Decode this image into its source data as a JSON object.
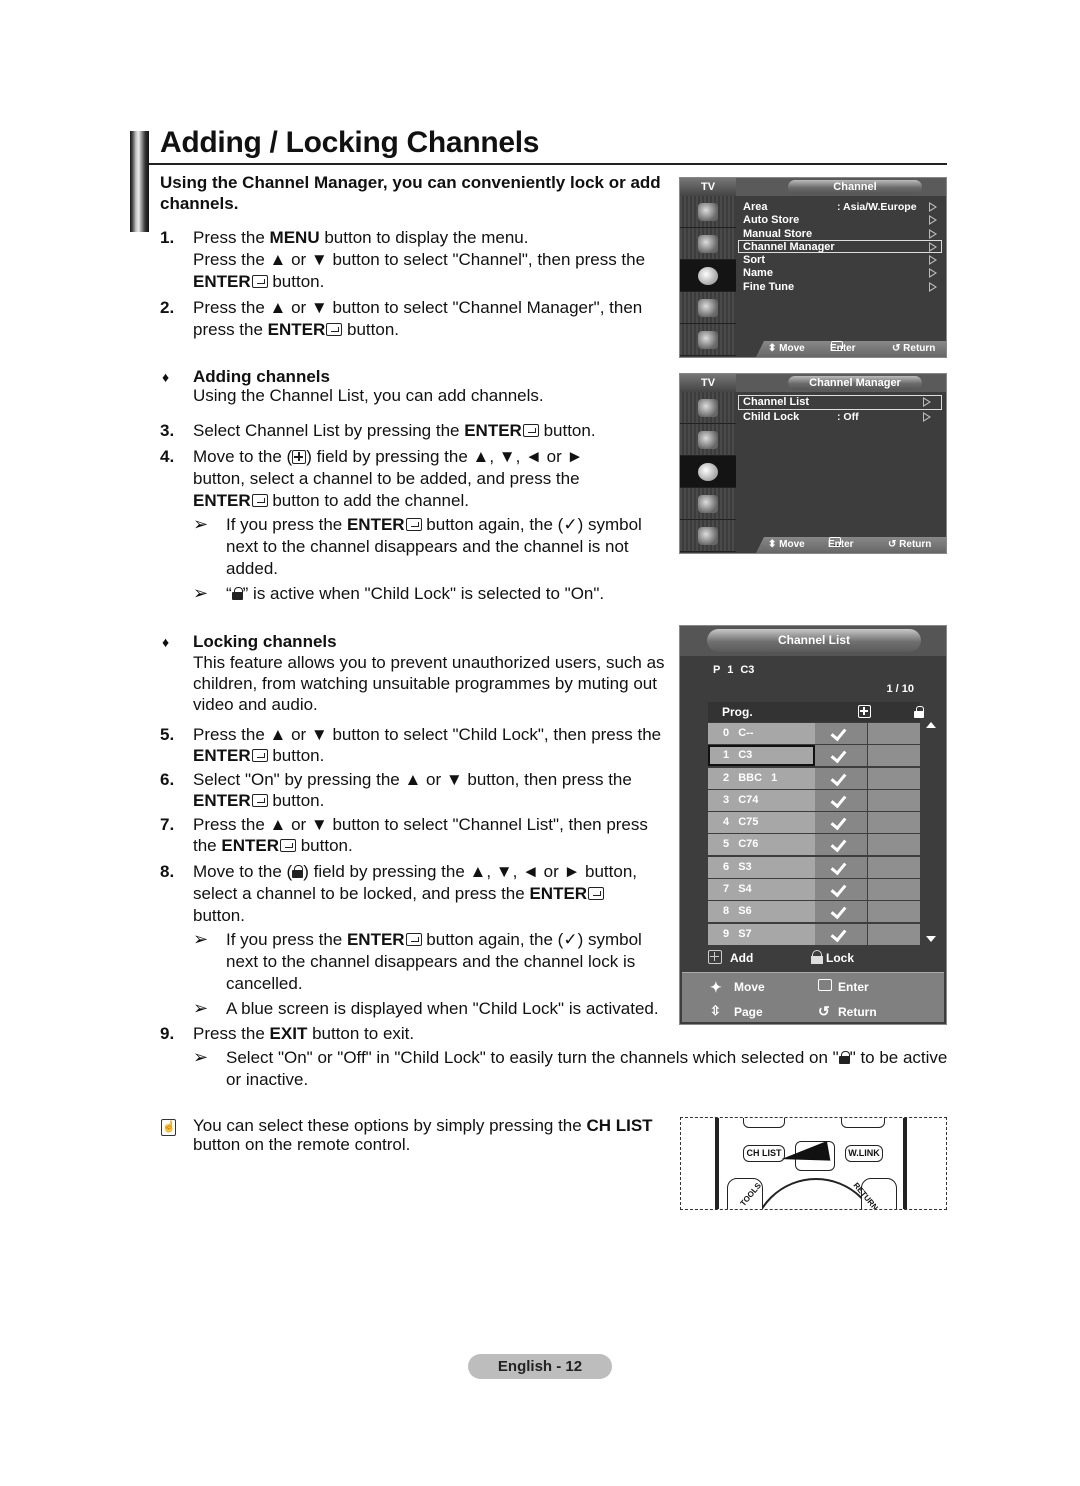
{
  "page": {
    "title": "Adding / Locking Channels",
    "intro": "Using the Channel Manager, you can conveniently lock or add channels.",
    "footer": "English - 12"
  },
  "steps": {
    "s1_num": "1.",
    "s1_a_pre": "Press the ",
    "s1_a_bold": "MENU",
    "s1_a_post": " button to display the menu.",
    "s1_b": "Press the ▲ or ▼ button to select \"Channel\", then press the",
    "s1_c_bold": "ENTER",
    "s1_c_post": " button.",
    "s2_num": "2.",
    "s2_a": "Press the ▲ or ▼ button to select \"Channel Manager\", then",
    "s2_b_pre": "press the ",
    "s2_b_bold": "ENTER",
    "s2_b_post": " button.",
    "adding_bullet": "♦",
    "adding_heading": "Adding channels",
    "adding_desc": "Using the Channel List, you can add channels.",
    "s3_num": "3.",
    "s3_pre": "Select Channel List by pressing the ",
    "s3_bold": "ENTER",
    "s3_post": " button.",
    "s4_num": "4.",
    "s4_a_pre": "Move to the (",
    "s4_a_post": ") field by pressing the ▲, ▼, ◄ or ►",
    "s4_b": "button, select a channel to be added, and press the",
    "s4_c_bold": "ENTER",
    "s4_c_post": " button to add the channel.",
    "note_arrow": "➢",
    "n1_a_pre": "If you press the ",
    "n1_a_bold": "ENTER",
    "n1_a_post": " button again, the (✓) symbol",
    "n1_b": "next to the channel disappears and the channel is not",
    "n1_c": "added.",
    "n2_pre": "“",
    "n2_post": "” is active when \"Child Lock\" is selected to \"On\".",
    "locking_bullet": "♦",
    "locking_heading": "Locking channels",
    "locking_desc_1": "This feature allows you to prevent unauthorized users, such as",
    "locking_desc_2": "children, from watching unsuitable programmes by muting out",
    "locking_desc_3": "video and audio.",
    "s5_num": "5.",
    "s5_a": "Press the ▲ or ▼ button to select \"Child Lock\", then press the",
    "s5_b_bold": "ENTER",
    "s5_b_post": " button.",
    "s6_num": "6.",
    "s6_a": "Select \"On\" by pressing the ▲ or ▼ button, then press the",
    "s6_b_bold": "ENTER",
    "s6_b_post": " button.",
    "s7_num": "7.",
    "s7_a": "Press the ▲ or ▼ button to select \"Channel List\", then press",
    "s7_b_pre": "the ",
    "s7_b_bold": "ENTER",
    "s7_b_post": " button.",
    "s8_num": "8.",
    "s8_a_pre": "Move to the (",
    "s8_a_post": ") field by pressing the ▲, ▼, ◄ or ► button,",
    "s8_b_pre": "select a channel to be locked, and press the ",
    "s8_b_bold": "ENTER",
    "s8_c": "button.",
    "n3_a_pre": "If you press the ",
    "n3_a_bold": "ENTER",
    "n3_a_post": " button again, the (✓) symbol",
    "n3_b": "next to the channel disappears and the channel lock is",
    "n3_c": "cancelled.",
    "n4": "A blue screen is displayed when \"Child Lock\" is activated.",
    "s9_num": "9.",
    "s9_pre": "Press the ",
    "s9_bold": "EXIT",
    "s9_post": " button to exit.",
    "n5_a_pre": "Select \"On\" or \"Off\" in \"Child Lock\" to easily turn the channels which selected on \"",
    "n5_a_post": "\" to be active",
    "n5_b": "or inactive.",
    "tip_icon": "☝",
    "tip_a_pre": "You can select these options by simply pressing the ",
    "tip_a_bold": "CH LIST",
    "tip_b": "button on the remote control."
  },
  "osd_channel": {
    "tab": "TV",
    "title": "Channel",
    "items": [
      {
        "label": "Area",
        "value": ": Asia/W.Europe"
      },
      {
        "label": "Auto Store",
        "value": ""
      },
      {
        "label": "Manual Store",
        "value": ""
      },
      {
        "label": "Channel Manager",
        "value": "",
        "selected": true
      },
      {
        "label": "Sort",
        "value": ""
      },
      {
        "label": "Name",
        "value": ""
      },
      {
        "label": "Fine Tune",
        "value": ""
      }
    ],
    "footer": {
      "move": "⬍ Move",
      "enter": "Enter",
      "return": "↺ Return"
    }
  },
  "osd_manager": {
    "tab": "TV",
    "title": "Channel Manager",
    "items": [
      {
        "label": "Channel List",
        "value": "",
        "selected": true
      },
      {
        "label": "Child Lock",
        "value": ": Off"
      }
    ],
    "footer": {
      "move": "⬍ Move",
      "enter": "Enter",
      "return": "↺ Return"
    }
  },
  "channel_list": {
    "title": "Channel List",
    "current": "P  1  C3",
    "page": "1 / 10",
    "col_prog": "Prog.",
    "rows": [
      {
        "num": "0",
        "name": "C--",
        "added": true,
        "locked": false
      },
      {
        "num": "1",
        "name": "C3",
        "added": true,
        "locked": false,
        "selected": true
      },
      {
        "num": "2",
        "name": "BBC 1",
        "added": true,
        "locked": false
      },
      {
        "num": "3",
        "name": "C74",
        "added": true,
        "locked": false
      },
      {
        "num": "4",
        "name": "C75",
        "added": true,
        "locked": false
      },
      {
        "num": "5",
        "name": "C76",
        "added": true,
        "locked": false
      },
      {
        "num": "6",
        "name": "S3",
        "added": true,
        "locked": false
      },
      {
        "num": "7",
        "name": "S4",
        "added": true,
        "locked": false
      },
      {
        "num": "8",
        "name": "S6",
        "added": true,
        "locked": false
      },
      {
        "num": "9",
        "name": "S7",
        "added": true,
        "locked": false
      }
    ],
    "legend_add": "Add",
    "legend_lock": "Lock",
    "nav_move": "Move",
    "nav_enter": "Enter",
    "nav_page": "Page",
    "nav_return": "Return"
  },
  "remote": {
    "ch_list": "CH LIST",
    "wlink": "W.LINK",
    "tools": "TOOLS",
    "return": "RETURN"
  }
}
